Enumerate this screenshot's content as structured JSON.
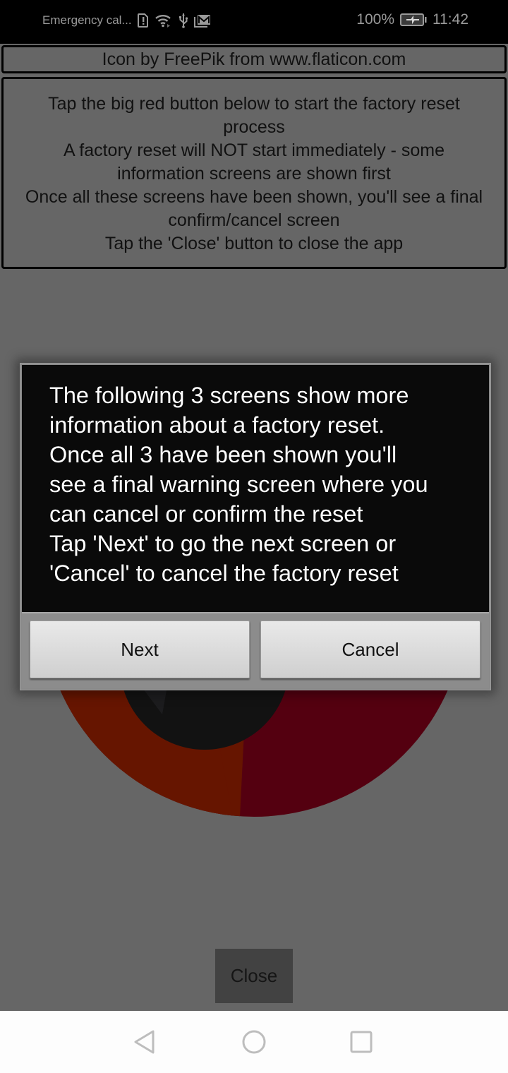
{
  "status_bar": {
    "carrier_text": "Emergency cal...",
    "icons": [
      "sim-alert-icon",
      "wifi-icon",
      "usb-icon",
      "gmail-icon"
    ],
    "battery_percent": "100%",
    "battery_icon": "battery-charging-icon",
    "time": "11:42"
  },
  "app": {
    "credit_text": "Icon by FreePik from www.flaticon.com",
    "info_lines": [
      "Tap the big red button below to start the factory reset",
      "process",
      "A factory reset will NOT start immediately - some",
      "information screens are shown first",
      "Once all these screens have been shown, you'll see a final",
      "confirm/cancel screen",
      "Tap the 'Close' button to close the app"
    ],
    "reset_icon": "factory-reset-icon",
    "colors": {
      "icon_orange": "#661500",
      "icon_red": "#540010",
      "icon_dark": "#121212"
    },
    "close_label": "Close"
  },
  "dialog": {
    "message_lines": [
      "The following 3 screens show more",
      "information about a factory reset.",
      "Once all 3 have been shown you'll",
      "see a final warning screen where you",
      "can cancel or confirm the reset",
      "Tap 'Next' to go the next screen or",
      "'Cancel' to cancel the factory reset"
    ],
    "next_label": "Next",
    "cancel_label": "Cancel"
  },
  "nav_bar": {
    "back": "back-icon",
    "home": "home-icon",
    "recents": "recents-icon"
  }
}
